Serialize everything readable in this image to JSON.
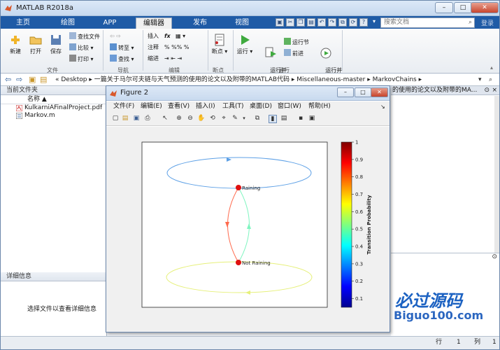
{
  "window": {
    "title": "MATLAB R2018a",
    "minimize": "–",
    "maximize": "□",
    "close": "✕"
  },
  "tabs": [
    "主页",
    "绘图",
    "APP",
    "编辑器",
    "发布",
    "视图"
  ],
  "search": {
    "placeholder": "搜索文档",
    "collapse_label": "登录"
  },
  "ribbon": {
    "file_group": {
      "new": "新建",
      "open": "打开",
      "save": "保存",
      "find_files": "查找文件",
      "compare": "比较",
      "print": "打印",
      "label": "文件"
    },
    "nav_group": {
      "goto": "转至",
      "find": "查找",
      "label": "导航"
    },
    "edit_group": {
      "insert": "插入",
      "comment": "注释",
      "indent": "缩进",
      "label": "编辑"
    },
    "breakpoints_group": {
      "breakpoints": "断点",
      "label": "断点"
    },
    "run_group": {
      "run": "运行",
      "run_advance": "运行并\n前进",
      "run_section": "运行节",
      "advance": "前进",
      "run_time": "运行并\n计时",
      "label": "运行"
    }
  },
  "address": {
    "path": [
      "Desktop",
      "一篇关于马尔可夫链与天气预测的使用的论文以及附带的MATLAB代码",
      "Miscellaneous-master",
      "MarkovChains"
    ]
  },
  "current_folder": {
    "header": "当前文件夹",
    "column": "名称 ▲",
    "files": [
      {
        "name": "KulkarniAFinalProject.pdf",
        "icon": "pdf-icon"
      },
      {
        "name": "Markov.m",
        "icon": "m-file-icon"
      }
    ],
    "details_header": "详细信息",
    "details_msg": "选择文件以查看详细信息"
  },
  "right_panel": {
    "header": "的使用的论文以及附带的MA..."
  },
  "status": {
    "row_label": "行",
    "row": "1",
    "col_label": "列",
    "col": "1"
  },
  "figure": {
    "title": "Figure 2",
    "menus": [
      "文件(F)",
      "编辑(E)",
      "查看(V)",
      "插入(I)",
      "工具(T)",
      "桌面(D)",
      "窗口(W)",
      "帮助(H)"
    ],
    "nodes": [
      "Raining",
      "Not Raining"
    ],
    "colorbar": {
      "label": "Transition Probability",
      "ticks": [
        "0.1",
        "0.2",
        "0.3",
        "0.4",
        "0.5",
        "0.6",
        "0.7",
        "0.8",
        "0.9",
        "1"
      ]
    },
    "edge_colors": {
      "rain_self": "#5da0e6",
      "rain_to_not": "#ff6a4d",
      "not_to_rain": "#7ff5c0",
      "not_self": "#e6f07a"
    }
  },
  "watermark": {
    "cn": "必过源码",
    "url": "Biguo100.com"
  }
}
